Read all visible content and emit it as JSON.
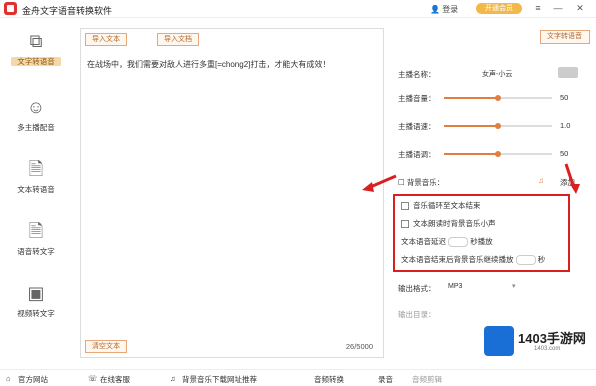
{
  "app": {
    "title": "金舟文字语音转换软件",
    "user_label": "登录",
    "vip_label": "开通会员"
  },
  "sidebar": {
    "items": [
      {
        "label": "文字转语音"
      },
      {
        "label": "多主播配音"
      },
      {
        "label": "文本转语音"
      },
      {
        "label": "语音转文字"
      },
      {
        "label": "视频转文字"
      }
    ]
  },
  "editor": {
    "tab1": "导入文本",
    "tab2": "导入文档",
    "text": "在战场中，我们需要对敌人进行多重[=chong2]打击，才能大有成效！",
    "count": "26/5000",
    "clear_button": "清空文本"
  },
  "right_panel": {
    "tts_button": "文字转语音",
    "anchor_label": "主播名称：",
    "anchor_value": "女声-小云",
    "volume_label": "主播音量：",
    "volume_value": "50",
    "volume_level": 0.5,
    "speed_label": "主播语速：",
    "speed_value": "1.0",
    "speed_level": 0.5,
    "pitch_label": "主播语调：",
    "pitch_value": "50",
    "pitch_level": 0.5,
    "bgm_label": "背景音乐：",
    "bgm_add": "添加",
    "opt1": "音乐循环至文本结束",
    "opt2": "文本朗读时背景音乐小声",
    "opt3_prefix": "文本语音延迟",
    "opt3_suffix": "秒播放",
    "opt4_prefix": "文本语音结束后背景音乐继续播放",
    "opt4_suffix": "秒",
    "format_label": "输出格式：",
    "format_value": "MP3",
    "output_label": "输出目录："
  },
  "footer": {
    "website": "官方网站",
    "service": "在线客服",
    "bgm_link": "背景音乐下载网址推荐",
    "tab_convert": "音频转换",
    "tab_record": "录音",
    "tab_clip": "音频剪辑"
  },
  "watermark": {
    "brand": "1403手游网",
    "url": "1403.com"
  }
}
